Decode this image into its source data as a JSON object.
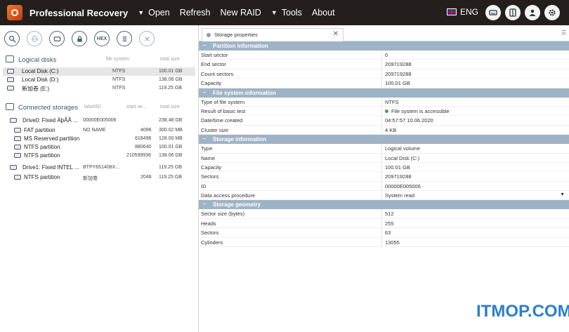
{
  "app": {
    "title": "Professional Recovery"
  },
  "menu": {
    "open": "Open",
    "refresh": "Refresh",
    "new_raid": "New RAID",
    "tools": "Tools",
    "about": "About"
  },
  "lang": "ENG",
  "toolbar": {
    "hex": "HEX"
  },
  "logical": {
    "title": "Logical disks",
    "col_fs": "file system",
    "col_size": "total size",
    "rows": [
      {
        "name": "Local Disk (C:)",
        "fs": "NTFS",
        "size": "100.01 GB"
      },
      {
        "name": "Local Disk (D:)",
        "fs": "NTFS",
        "size": "138.06 GB"
      },
      {
        "name": "新加卷 (E:)",
        "fs": "NTFS",
        "size": "119.25 GB"
      }
    ]
  },
  "storages": {
    "title": "Connected storages",
    "col_label": "label/ID",
    "col_start": "start se...",
    "col_size": "total size",
    "drive0": {
      "name": "Drive0: Fixed ÀþÃÃ ...",
      "id": "00000E005006",
      "size": "238.48 GB"
    },
    "drive0_parts": [
      {
        "name": "FAT partition",
        "label": "NO NAME",
        "start": "4096",
        "size": "300.02 MB"
      },
      {
        "name": "MS Reserved partition",
        "label": "",
        "start": "618496",
        "size": "128.00 MB"
      },
      {
        "name": "NTFS partition",
        "label": "",
        "start": "880640",
        "size": "100.01 GB"
      },
      {
        "name": "NTFS partition",
        "label": "",
        "start": "210599936",
        "size": "138.06 GB"
      }
    ],
    "drive1": {
      "name": "Drive1: Fixed INTEL ...",
      "id": "BTPY651408X...",
      "size": "119.25 GB"
    },
    "drive1_parts": [
      {
        "name": "NTFS partition",
        "label": "新加卷",
        "start": "2048",
        "size": "119.25 GB"
      }
    ]
  },
  "tab": {
    "label": "Storage properties"
  },
  "groups": {
    "partition": "Partition information",
    "filesystem": "File system information",
    "storage": "Storage information",
    "geometry": "Storage geometry"
  },
  "partition_rows": [
    {
      "k": "Start sector",
      "v": "0"
    },
    {
      "k": "End sector",
      "v": "209719288"
    },
    {
      "k": "Count sectors",
      "v": "209719288"
    },
    {
      "k": "Capacity",
      "v": "100.01 GB"
    }
  ],
  "fs_rows": {
    "type": {
      "k": "Type of file system",
      "v": "NTFS"
    },
    "result": {
      "k": "Result of basic test",
      "v": "File system is accessible"
    },
    "date": {
      "k": "Date/time created",
      "v": "04:57:57 10.06.2020"
    },
    "cluster": {
      "k": "Cluster size",
      "v": "4 KB"
    }
  },
  "storage_rows": [
    {
      "k": "Type",
      "v": "Logical volume"
    },
    {
      "k": "Name",
      "v": "Local Disk (C:)"
    },
    {
      "k": "Capacity",
      "v": "100.01 GB"
    },
    {
      "k": "Sectors",
      "v": "209719288"
    },
    {
      "k": "ID",
      "v": "00000E005006"
    }
  ],
  "access": {
    "k": "Data access procedure",
    "v": "System read"
  },
  "geometry_rows": [
    {
      "k": "Sector size (bytes)",
      "v": "512"
    },
    {
      "k": "Heads",
      "v": "255"
    },
    {
      "k": "Sectors",
      "v": "63"
    },
    {
      "k": "Cylinders",
      "v": "13055"
    }
  ],
  "watermark": "ITMOP.COM",
  "colors": {
    "topbar": "#241f1c",
    "group_header": "#9fb3c6",
    "accent": "#4a6079",
    "ok": "#3fa34d",
    "watermark": "#2b7fc9"
  }
}
